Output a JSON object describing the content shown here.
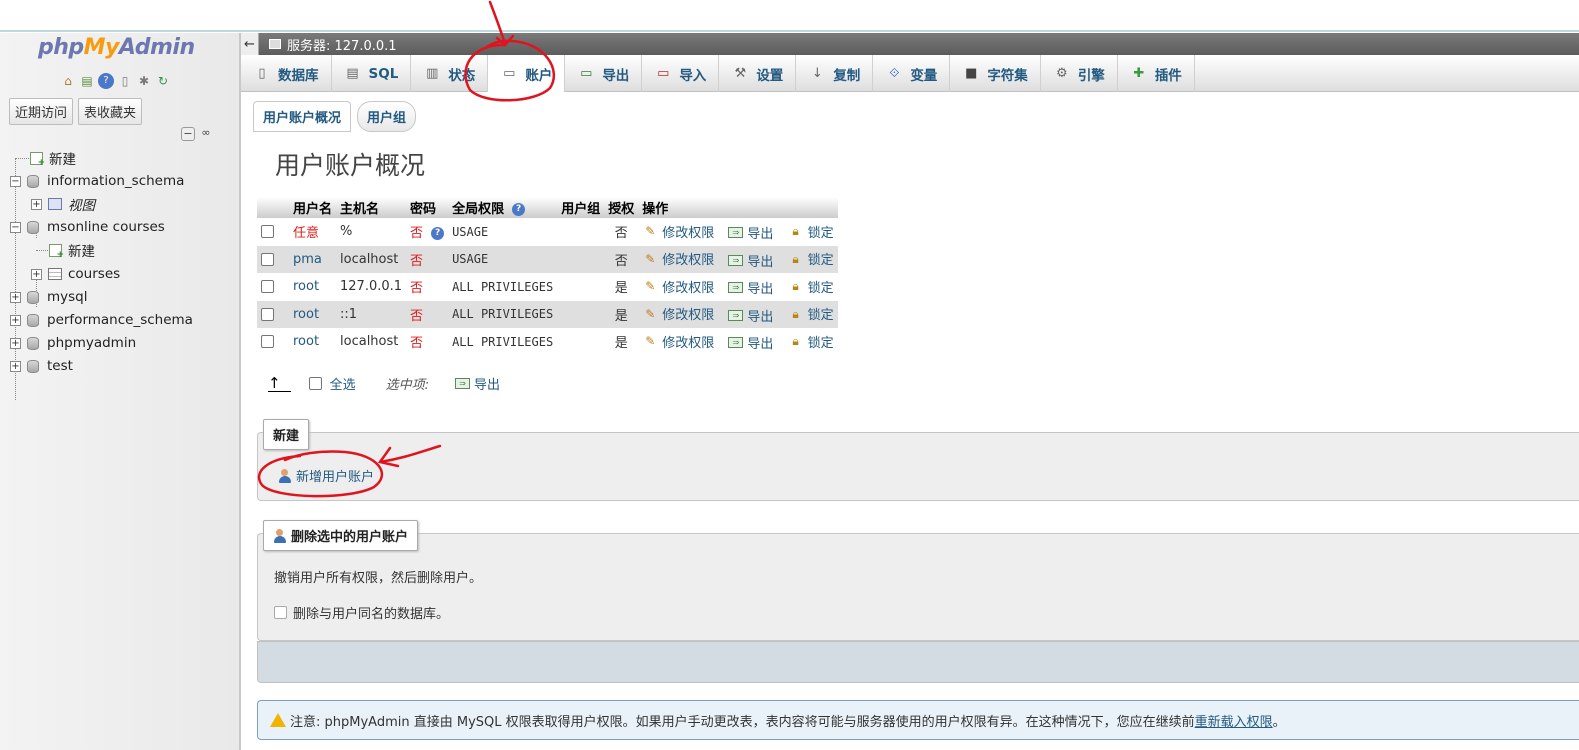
{
  "sidebar": {
    "logo": {
      "php": "php",
      "my": "My",
      "admin": "Admin"
    },
    "icons": [
      "home-icon",
      "database-icon",
      "help-icon",
      "docs-icon",
      "settings-icon",
      "reload-icon"
    ],
    "tabs": [
      "近期访问",
      "表收藏夹"
    ],
    "tree": [
      {
        "label": "新建",
        "type": "new"
      },
      {
        "label": "information_schema",
        "type": "db"
      },
      {
        "label": "视图",
        "type": "view"
      },
      {
        "label": "msonline courses",
        "type": "db"
      },
      {
        "label": "新建",
        "type": "new"
      },
      {
        "label": "courses",
        "type": "table"
      },
      {
        "label": "mysql",
        "type": "db"
      },
      {
        "label": "performance_schema",
        "type": "db"
      },
      {
        "label": "phpmyadmin",
        "type": "db"
      },
      {
        "label": "test",
        "type": "db"
      }
    ]
  },
  "server_bar": {
    "label": "服务器: 127.0.0.1"
  },
  "nav_tabs": [
    {
      "label": "数据库",
      "icon": "database-icon"
    },
    {
      "label": "SQL",
      "icon": "sql-icon"
    },
    {
      "label": "状态",
      "icon": "status-icon"
    },
    {
      "label": "账户",
      "icon": "accounts-icon"
    },
    {
      "label": "导出",
      "icon": "export-icon"
    },
    {
      "label": "导入",
      "icon": "import-icon"
    },
    {
      "label": "设置",
      "icon": "wrench-icon"
    },
    {
      "label": "复制",
      "icon": "replication-icon"
    },
    {
      "label": "变量",
      "icon": "variables-icon"
    },
    {
      "label": "字符集",
      "icon": "charset-icon"
    },
    {
      "label": "引擎",
      "icon": "engine-icon"
    },
    {
      "label": "插件",
      "icon": "plugin-icon"
    }
  ],
  "sub_tabs": [
    "用户账户概况",
    "用户组"
  ],
  "page_title": "用户账户概况",
  "table": {
    "headers": [
      "用户名",
      "主机名",
      "密码",
      "全局权限",
      "用户组",
      "授权",
      "操作"
    ],
    "rows": [
      {
        "user": "任意",
        "host": "%",
        "password": "否",
        "privileges": "USAGE",
        "group": "",
        "grant": "否"
      },
      {
        "user": "pma",
        "host": "localhost",
        "password": "否",
        "privileges": "USAGE",
        "group": "",
        "grant": "否"
      },
      {
        "user": "root",
        "host": "127.0.0.1",
        "password": "否",
        "privileges": "ALL PRIVILEGES",
        "group": "",
        "grant": "是"
      },
      {
        "user": "root",
        "host": "::1",
        "password": "否",
        "privileges": "ALL PRIVILEGES",
        "group": "",
        "grant": "是"
      },
      {
        "user": "root",
        "host": "localhost",
        "password": "否",
        "privileges": "ALL PRIVILEGES",
        "group": "",
        "grant": "是"
      }
    ],
    "actions": {
      "edit": "修改权限",
      "export": "导出",
      "lock": "锁定"
    }
  },
  "bulk": {
    "select_all": "全选",
    "with_selected": "选中项:",
    "export": "导出"
  },
  "new_section": {
    "legend": "新建",
    "add_user": "新增用户账户"
  },
  "delete_section": {
    "legend": "删除选中的用户账户",
    "description": "撤销用户所有权限，然后删除用户。",
    "option": "删除与用户同名的数据库。"
  },
  "notice": {
    "text": "注意: phpMyAdmin 直接由 MySQL 权限表取得用户权限。如果用户手动更改表，表内容将可能与服务器使用的用户权限有异。在这种情况下，您应在继续前",
    "link": "重新载入权限",
    "end": "。"
  },
  "colors": {
    "link": "#235a81",
    "no": "#e01b1b",
    "annotation": "#e0141e"
  }
}
